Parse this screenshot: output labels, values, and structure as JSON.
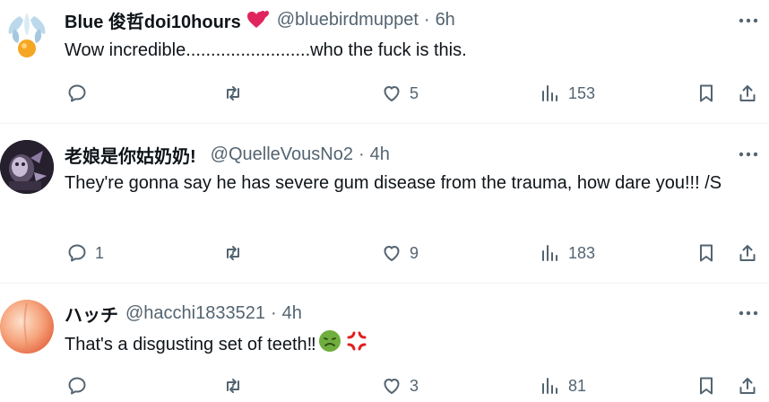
{
  "replies": [
    {
      "name": "Blue 俊哲doi10hours",
      "handle": "@bluebirdmuppet",
      "separator": "·",
      "time": "6h",
      "text": "Wow incredible.........................who the fuck is this.",
      "counts": {
        "reply": "",
        "repost": "",
        "like": "5",
        "views": "153"
      },
      "avatar_colors": [
        "#d9ecf6",
        "#f5a623"
      ],
      "name_badge_icon": "two-hearts-icon"
    },
    {
      "name": "老娘是你姑奶奶!",
      "handle": "@QuelleVousNo2",
      "separator": "·",
      "time": "4h",
      "text": "They're gonna say he has severe gum disease from the trauma, how dare you!!! /S",
      "counts": {
        "reply": "1",
        "repost": "",
        "like": "9",
        "views": "183"
      },
      "avatar_colors": [
        "#2a2233",
        "#b7a9c9"
      ]
    },
    {
      "name": "ハッチ",
      "handle": "@hacchi1833521",
      "separator": "·",
      "time": "4h",
      "text": "That's a disgusting set of teeth‼",
      "trailing_emojis": [
        "nauseated-face-icon",
        "anger-symbol-icon"
      ],
      "counts": {
        "reply": "",
        "repost": "",
        "like": "3",
        "views": "81"
      },
      "avatar_colors": [
        "#f6b08e",
        "#e8704a"
      ]
    }
  ],
  "colors": {
    "text": "#0f1419",
    "secondary": "#536471",
    "divider": "#eff3f4",
    "heart_badge": "#e0245e",
    "nauseated": "#6fae3d",
    "anger": "#e02121"
  }
}
